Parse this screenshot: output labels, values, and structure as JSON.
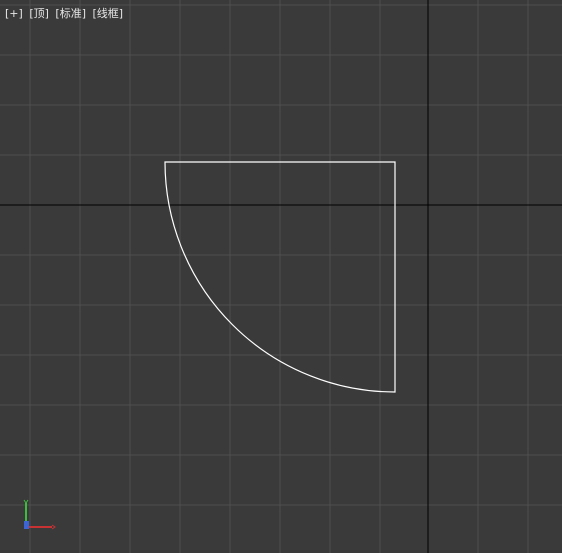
{
  "viewport": {
    "menu_plus": "[+]",
    "view_name": "[顶]",
    "shading_mode": "[标准]",
    "display_mode": "[线框]"
  },
  "colors": {
    "background": "#3a3a3a",
    "grid_line": "#4f4f4f",
    "home_grid_axis": "#000000",
    "shape": "#ffffff",
    "gizmo_x": "#c83232",
    "gizmo_y": "#3cbe3c",
    "gizmo_z": "#3c64d2"
  },
  "scene": {
    "object_shape": "quarter-circle (pie slice) spline, wireframe",
    "gizmo_icon": "axis-tripod-icon"
  }
}
